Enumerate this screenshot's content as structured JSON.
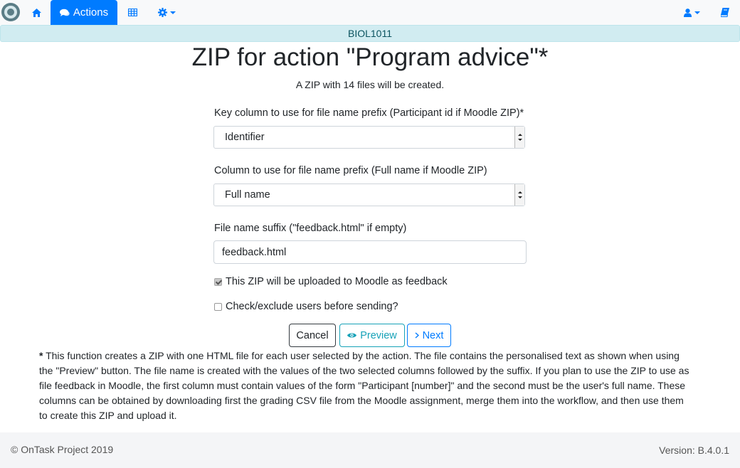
{
  "navbar": {
    "logo": "ontask-logo",
    "home_icon": "home-icon",
    "actions_label": "Actions",
    "actions_icon": "comments-icon",
    "table_icon": "table-icon",
    "settings_icon": "gear-icon",
    "user_icon": "user-icon",
    "book_icon": "book-icon",
    "accent_color": "#007bff"
  },
  "course_bar": {
    "label": "BIOL1011"
  },
  "page": {
    "title": "ZIP for action \"Program advice\"*",
    "subtitle": "A ZIP with 14 files will be created."
  },
  "form": {
    "key_column": {
      "label": "Key column to use for file name prefix (Participant id if Moodle ZIP)*",
      "selected": "Identifier"
    },
    "name_column": {
      "label": "Column to use for file name prefix (Full name if Moodle ZIP)",
      "selected": "Full name"
    },
    "suffix": {
      "label": "File name suffix (\"feedback.html\" if empty)",
      "value": "feedback.html"
    },
    "moodle_checkbox": {
      "label": "This ZIP will be uploaded to Moodle as feedback",
      "checked": true
    },
    "exclude_checkbox": {
      "label": "Check/exclude users before sending?",
      "checked": false
    }
  },
  "buttons": {
    "cancel": "Cancel",
    "preview": "Preview",
    "next": "Next"
  },
  "footnote": {
    "marker": "*",
    "text": "This function creates a ZIP with one HTML file for each user selected by the action. The file contains the personalised text as shown when using the \"Preview\" button. The file name is created with the values of the two selected columns followed by the suffix. If you plan to use the ZIP to use as file feedback in Moodle, the first column must contain values of the form \"Participant [number]\" and the second must be the user's full name. These columns can be obtained by downloading first the grading CSV file from the Moodle assignment, merge them into the workflow, and then use them to create this ZIP and upload it."
  },
  "footer": {
    "copyright": "© OnTask Project 2019",
    "version": "Version: B.4.0.1"
  }
}
